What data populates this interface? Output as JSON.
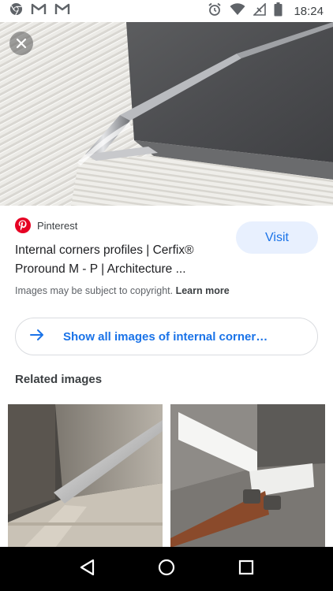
{
  "status_bar": {
    "time": "18:24",
    "left_icons": [
      "chrome-icon",
      "gmail-icon",
      "gmail-icon"
    ],
    "right_icons": [
      "alarm-icon",
      "wifi-icon",
      "no-signal-icon",
      "battery-icon"
    ]
  },
  "result": {
    "source_name": "Pinterest",
    "title": "Internal corners profiles | Cerfix® Proround M - P | Architecture ...",
    "visit_label": "Visit",
    "copyright_text": "Images may be subject to copyright.",
    "learn_more_label": "Learn more",
    "show_all_label": "Show all images of internal corner…"
  },
  "related": {
    "heading": "Related images",
    "items": [
      {
        "icon": "related-image-1"
      },
      {
        "icon": "related-image-2"
      }
    ]
  },
  "nav": {
    "icons": [
      "back-icon",
      "home-icon",
      "recents-icon"
    ]
  },
  "colors": {
    "accent": "#1a73e8",
    "visit_bg": "#e8f0fe",
    "pinterest": "#e60023"
  }
}
